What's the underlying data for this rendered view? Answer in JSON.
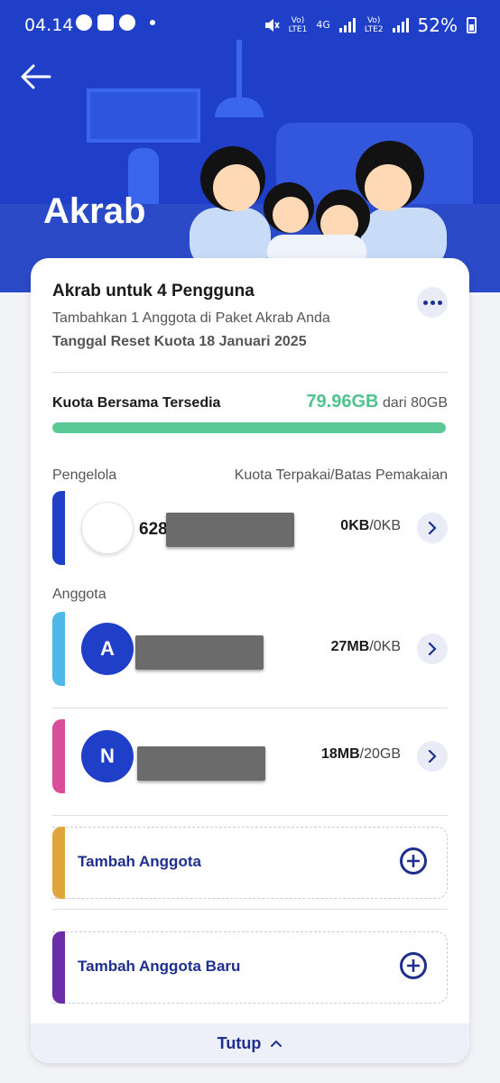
{
  "status_bar": {
    "time": "04.14",
    "net1_top": "Vo)",
    "net1_bottom": "LTE1",
    "net_gen": "4G",
    "net2_top": "Vo)",
    "net2_bottom": "LTE2",
    "battery": "52%"
  },
  "header": {
    "title": "Akrab"
  },
  "plan": {
    "title": "Akrab untuk 4 Pengguna",
    "subtitle": "Tambahkan 1 Anggota di Paket Akrab Anda",
    "reset_date": "Tanggal Reset Kuota 18 Januari 2025"
  },
  "quota": {
    "label": "Kuota Bersama Tersedia",
    "available": "79.96GB",
    "total_text": "dari 80GB",
    "fraction_available": 0.9995
  },
  "manager_section": {
    "label": "Pengelola",
    "right_label": "Kuota Terpakai/Batas Pemakaian"
  },
  "manager": {
    "number_prefix": "628",
    "used": "0KB",
    "limit": "/0KB"
  },
  "members_section": {
    "label": "Anggota"
  },
  "members": [
    {
      "initial": "A",
      "used": "27MB",
      "limit": "/0KB"
    },
    {
      "initial": "N",
      "used": "18MB",
      "limit": "/20GB"
    }
  ],
  "actions": {
    "add_member": "Tambah Anggota",
    "add_new_member": "Tambah Anggota Baru"
  },
  "footer": {
    "close_label": "Tutup"
  },
  "colors": {
    "header_bg": "#1f3fc9",
    "quota_green": "#4fc38f",
    "manager_stripe": "#1f3fc9",
    "member_a_stripe": "#4fb8e8",
    "member_n_stripe": "#d94e9b",
    "add_member_stripe": "#e0a63a",
    "add_new_member_stripe": "#6a2fa8",
    "accent_navy": "#1e2f8f"
  }
}
